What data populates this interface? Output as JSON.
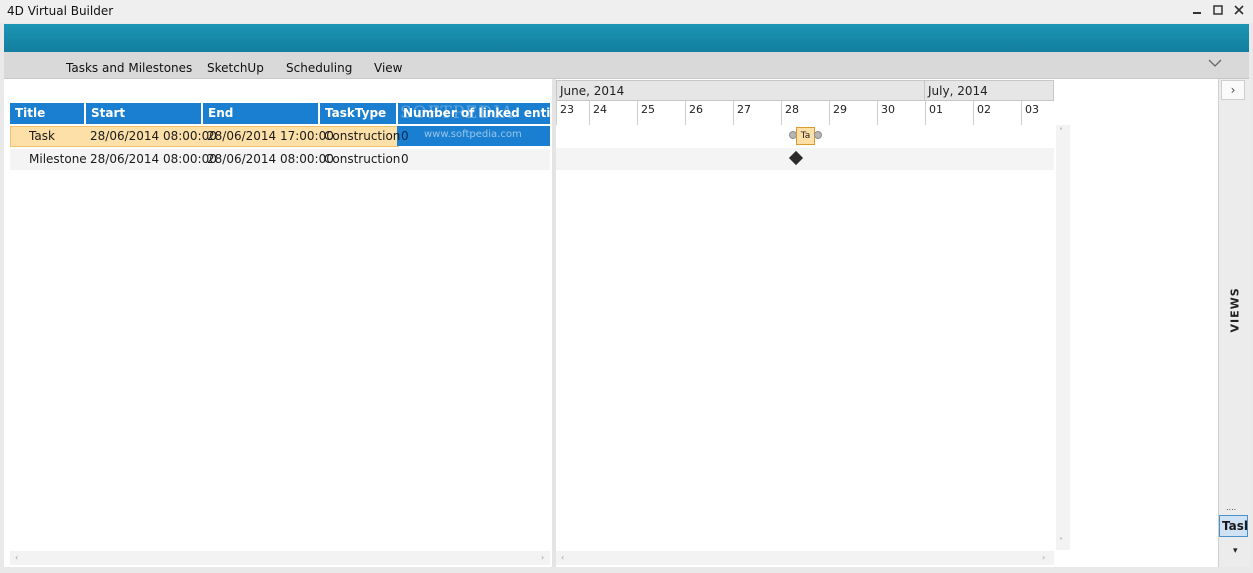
{
  "window": {
    "title": "4D Virtual Builder",
    "controls": {
      "minimize": "▬",
      "maximize": "☐",
      "close": "✕"
    }
  },
  "menu": {
    "items": [
      "Tasks and Milestones",
      "SketchUp",
      "Scheduling",
      "View"
    ]
  },
  "grid": {
    "columns": [
      "Title",
      "Start",
      "End",
      "TaskType",
      "Number of linked entities"
    ],
    "rows": [
      {
        "title": "Task",
        "start": "28/06/2014 08:00:00",
        "end": "28/06/2014 17:00:00",
        "tasktype": "Construction",
        "linked": "0",
        "selected": true
      },
      {
        "title": "Milestone",
        "start": "28/06/2014 08:00:00",
        "end": "28/06/2014 08:00:00",
        "tasktype": "Construction",
        "linked": "0",
        "selected": false
      }
    ],
    "watermark": "SOFTPEDIA",
    "watermark_url": "www.softpedia.com"
  },
  "gantt": {
    "months": [
      "June, 2014",
      "July, 2014"
    ],
    "days": [
      "23",
      "24",
      "25",
      "26",
      "27",
      "28",
      "29",
      "30",
      "01",
      "02",
      "03"
    ],
    "task_bar_label": "Ta"
  },
  "views_panel": {
    "label": "VIEWS",
    "tab_label": "Task",
    "grip": "....",
    "expand_glyph": "›",
    "dropdown_glyph": "▾"
  },
  "colors": {
    "accent": "#1a7fd0",
    "ribbon": "#137e9f",
    "selection": "#fde0a8"
  }
}
